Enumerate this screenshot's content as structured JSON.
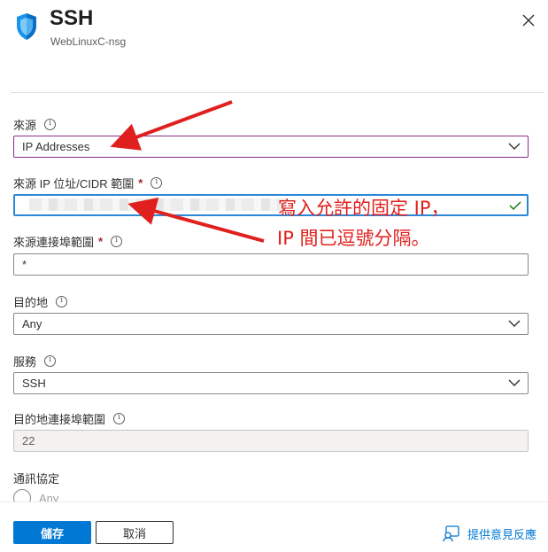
{
  "header": {
    "title": "SSH",
    "subtitle": "WebLinuxC-nsg",
    "icon": "shield-icon",
    "close_icon": "close-icon"
  },
  "form": {
    "source": {
      "label": "來源",
      "value": "IP Addresses"
    },
    "source_ip": {
      "label": "來源 IP 位址/CIDR 範圍",
      "required": "*"
    },
    "source_port": {
      "label": "來源連接埠範圍",
      "required": "*",
      "value": "*"
    },
    "destination": {
      "label": "目的地",
      "value": "Any"
    },
    "service": {
      "label": "服務",
      "value": "SSH"
    },
    "dest_port": {
      "label": "目的地連接埠範圍",
      "value": "22"
    },
    "protocol": {
      "label": "通訊協定",
      "option": "Any"
    }
  },
  "annotation": {
    "line1": "寫入允許的固定 IP，",
    "line2": "IP 間已逗號分隔。",
    "color": "#e0201e"
  },
  "footer": {
    "save_label": "儲存",
    "cancel_label": "取消",
    "feedback_label": "提供意見反應"
  },
  "colors": {
    "accent": "#0078d4",
    "annotation": "#e0201e",
    "focus": "#2b88d8"
  }
}
